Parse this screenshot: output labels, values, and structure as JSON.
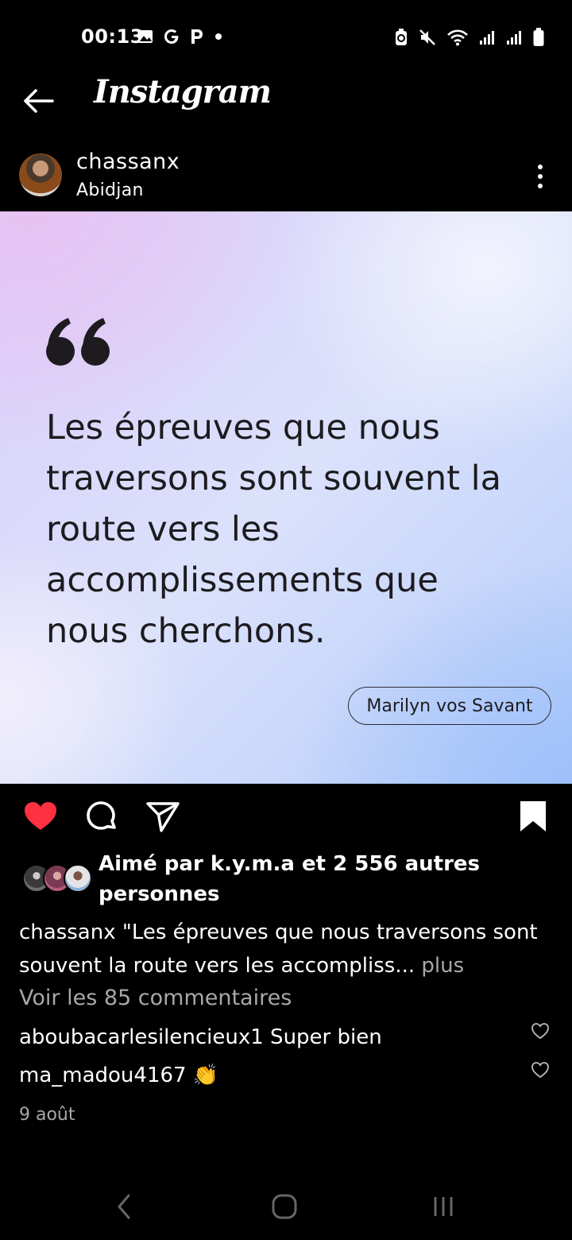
{
  "status_bar": {
    "time": "00:13",
    "left_icons": [
      "gallery-icon",
      "google-icon",
      "p-icon",
      "dot-icon"
    ],
    "right_icons": [
      "battery-saver-icon",
      "mute-icon",
      "wifi-icon",
      "signal-icon",
      "signal-icon",
      "battery-icon"
    ]
  },
  "header": {
    "title": "Instagram"
  },
  "post": {
    "username": "chassanx",
    "location": "Abidjan",
    "quote_mark": "❝",
    "quote": "Les épreuves que nous traversons sont souvent la route vers les accomplissements que nous cherchons.",
    "author": "Marilyn vos Savant",
    "liked": true,
    "likes_text": "Aimé par k.y.m.a et 2 556 autres personnes",
    "caption_username": "chassanx",
    "caption_text": " \"Les épreuves que nous traversons sont souvent la route vers les accompliss...",
    "caption_more": " plus",
    "view_comments": "Voir les 85 commentaires",
    "comments": [
      {
        "user": "aboubacarlesilencieux1",
        "text": " Super bien"
      },
      {
        "user": "ma_madou4167",
        "text": " 👏"
      }
    ],
    "date": "9 août"
  },
  "colors": {
    "like_red": "#ff3040",
    "muted_text": "#a8a8a8",
    "quote_text": "#1d1b1f"
  }
}
